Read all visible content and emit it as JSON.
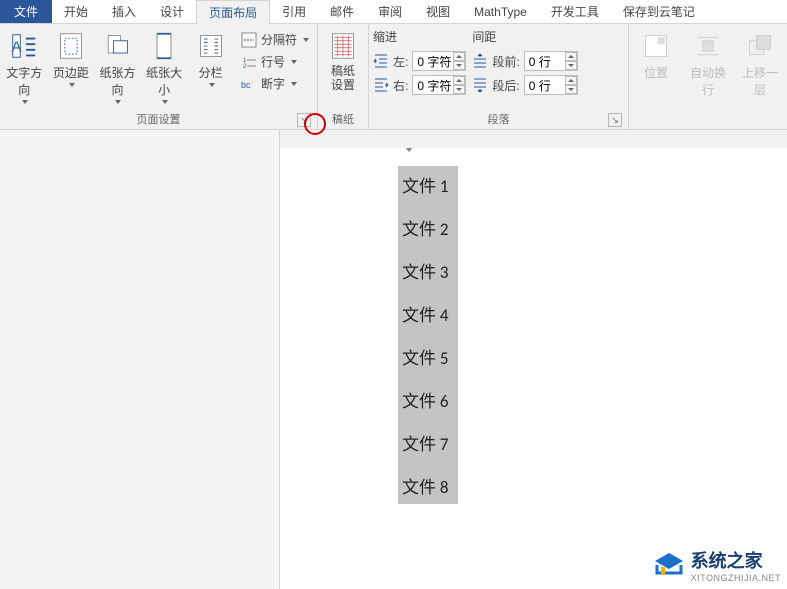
{
  "tabs": {
    "file": "文件",
    "items": [
      "开始",
      "插入",
      "设计",
      "页面布局",
      "引用",
      "邮件",
      "审阅",
      "视图",
      "MathType",
      "开发工具",
      "保存到云笔记"
    ],
    "activeIndex": 3
  },
  "ribbon": {
    "page_setup": {
      "label": "页面设置",
      "text_direction": "文字方向",
      "margins": "页边距",
      "orientation": "纸张方向",
      "size": "纸张大小",
      "columns": "分栏",
      "breaks": "分隔符",
      "line_numbers": "行号",
      "hyphenation": "断字"
    },
    "manuscript": {
      "label": "稿纸",
      "settings": "稿纸\n设置"
    },
    "paragraph": {
      "label": "段落",
      "indent_title": "缩进",
      "spacing_title": "间距",
      "indent_left_label": "左:",
      "indent_right_label": "右:",
      "indent_left_value": "0 字符",
      "indent_right_value": "0 字符",
      "before_label": "段前:",
      "after_label": "段后:",
      "before_value": "0 行",
      "after_value": "0 行"
    },
    "arrange": {
      "position": "位置",
      "wrap": "自动换行",
      "bring_forward": "上移一层"
    }
  },
  "document": {
    "items": [
      "文件 1",
      "文件 2",
      "文件 3",
      "文件 4",
      "文件 5",
      "文件 6",
      "文件 7",
      "文件 8"
    ]
  },
  "watermark": {
    "cn": "系统之家",
    "en": "XITONGZHIJIA.NET"
  }
}
